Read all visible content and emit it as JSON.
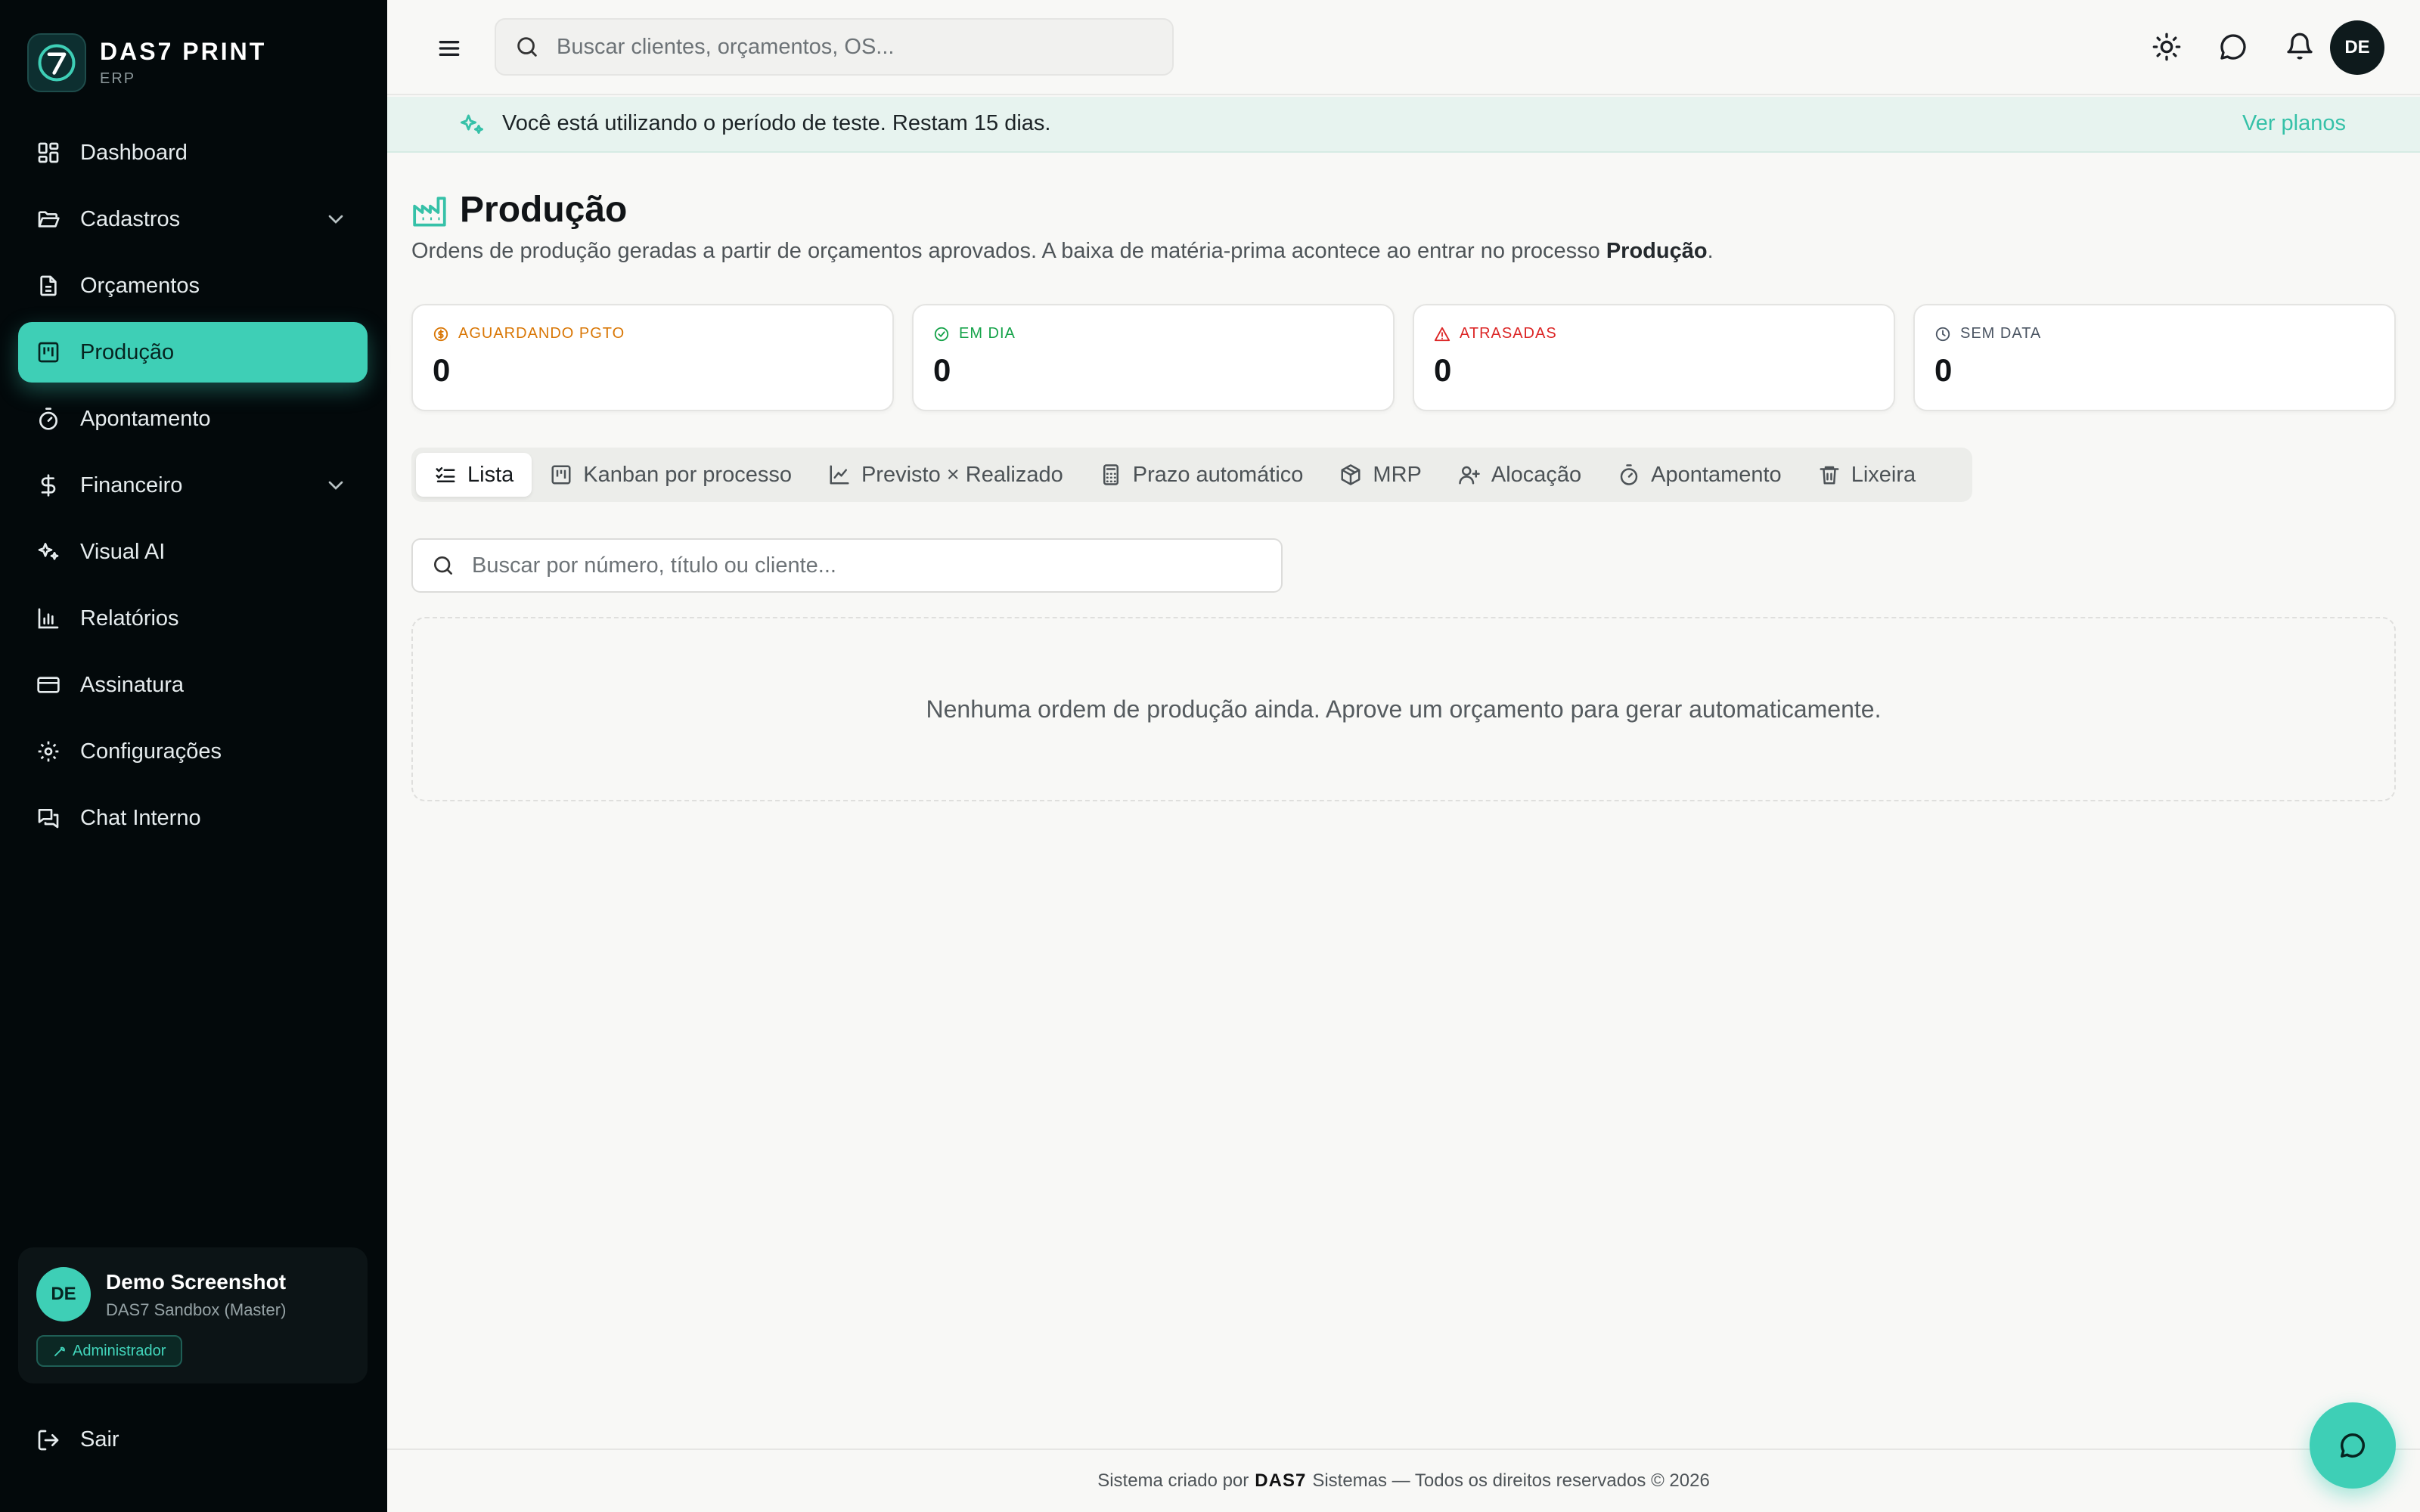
{
  "brand": {
    "name": "DAS7 PRINT",
    "sub": "ERP"
  },
  "sidebar": {
    "items": [
      {
        "label": "Dashboard",
        "icon": "dashboard-icon"
      },
      {
        "label": "Cadastros",
        "icon": "folder-icon",
        "expandable": true
      },
      {
        "label": "Orçamentos",
        "icon": "document-icon"
      },
      {
        "label": "Produção",
        "icon": "kanban-icon",
        "active": true
      },
      {
        "label": "Apontamento",
        "icon": "timer-icon"
      },
      {
        "label": "Financeiro",
        "icon": "dollar-icon",
        "expandable": true
      },
      {
        "label": "Visual AI",
        "icon": "sparkles-icon"
      },
      {
        "label": "Relatórios",
        "icon": "bar-chart-icon"
      },
      {
        "label": "Assinatura",
        "icon": "credit-card-icon"
      },
      {
        "label": "Configurações",
        "icon": "gear-icon"
      },
      {
        "label": "Chat Interno",
        "icon": "chat-icon"
      }
    ],
    "user": {
      "initials": "DE",
      "name": "Demo Screenshot",
      "org": "DAS7 Sandbox (Master)",
      "role": "Administrador"
    },
    "logout": "Sair"
  },
  "topbar": {
    "search_placeholder": "Buscar clientes, orçamentos, OS...",
    "avatar_initials": "DE"
  },
  "trial": {
    "message": "Você está utilizando o período de teste. Restam 15 dias.",
    "link": "Ver planos"
  },
  "page": {
    "title": "Produção",
    "description_prefix": "Ordens de produção geradas a partir de orçamentos aprovados. A baixa de matéria-prima acontece ao entrar no processo ",
    "description_bold": "Produção",
    "description_suffix": "."
  },
  "stats": [
    {
      "label": "AGUARDANDO PGTO",
      "value": "0",
      "color": "#d97706",
      "icon": "dollar-circle-icon"
    },
    {
      "label": "EM DIA",
      "value": "0",
      "color": "#16a34a",
      "icon": "check-circle-icon"
    },
    {
      "label": "ATRASADAS",
      "value": "0",
      "color": "#dc2626",
      "icon": "warning-icon"
    },
    {
      "label": "SEM DATA",
      "value": "0",
      "color": "#4b5563",
      "icon": "clock-icon"
    }
  ],
  "tabs": [
    {
      "label": "Lista",
      "icon": "list-check-icon",
      "active": true
    },
    {
      "label": "Kanban por processo",
      "icon": "kanban-icon"
    },
    {
      "label": "Previsto × Realizado",
      "icon": "line-chart-icon"
    },
    {
      "label": "Prazo automático",
      "icon": "calculator-icon"
    },
    {
      "label": "MRP",
      "icon": "package-icon"
    },
    {
      "label": "Alocação",
      "icon": "user-plus-icon"
    },
    {
      "label": "Apontamento",
      "icon": "timer-icon"
    },
    {
      "label": "Lixeira",
      "icon": "trash-icon"
    }
  ],
  "list": {
    "search_placeholder": "Buscar por número, título ou cliente...",
    "empty_message": "Nenhuma ordem de produção ainda. Aprove um orçamento para gerar automaticamente."
  },
  "footer": {
    "prefix": "Sistema criado por",
    "brand": "DAS7",
    "suffix": "Sistemas — Todos os direitos reservados © 2026"
  },
  "colors": {
    "accent": "#3ecfb6",
    "sidebar_bg": "#03090b"
  }
}
